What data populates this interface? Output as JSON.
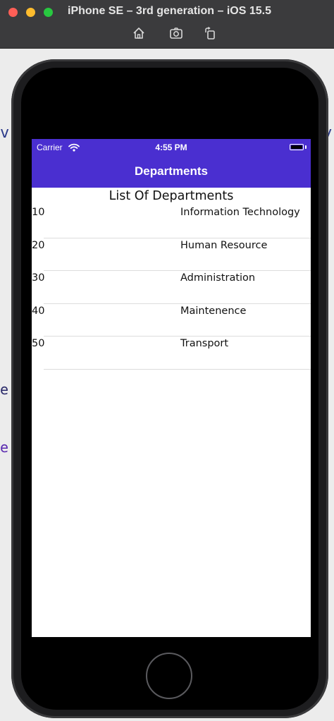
{
  "simulator": {
    "title": "iPhone SE – 3rd generation – iOS 15.5"
  },
  "status_bar": {
    "carrier": "Carrier",
    "time": "4:55 PM"
  },
  "nav": {
    "title": "Departments"
  },
  "list": {
    "title": "List Of Departments",
    "items": [
      {
        "id": "10",
        "name": "Information Technology"
      },
      {
        "id": "20",
        "name": "Human Resource"
      },
      {
        "id": "30",
        "name": "Administration"
      },
      {
        "id": "40",
        "name": "Maintenence"
      },
      {
        "id": "50",
        "name": "Transport"
      }
    ]
  },
  "colors": {
    "header": "#4a2fd0",
    "screen_bg": "#ffffff",
    "device": "#1d1d1f"
  },
  "icons": [
    "home-icon",
    "screenshot-icon",
    "rotate-icon",
    "wifi-icon",
    "battery-icon"
  ]
}
